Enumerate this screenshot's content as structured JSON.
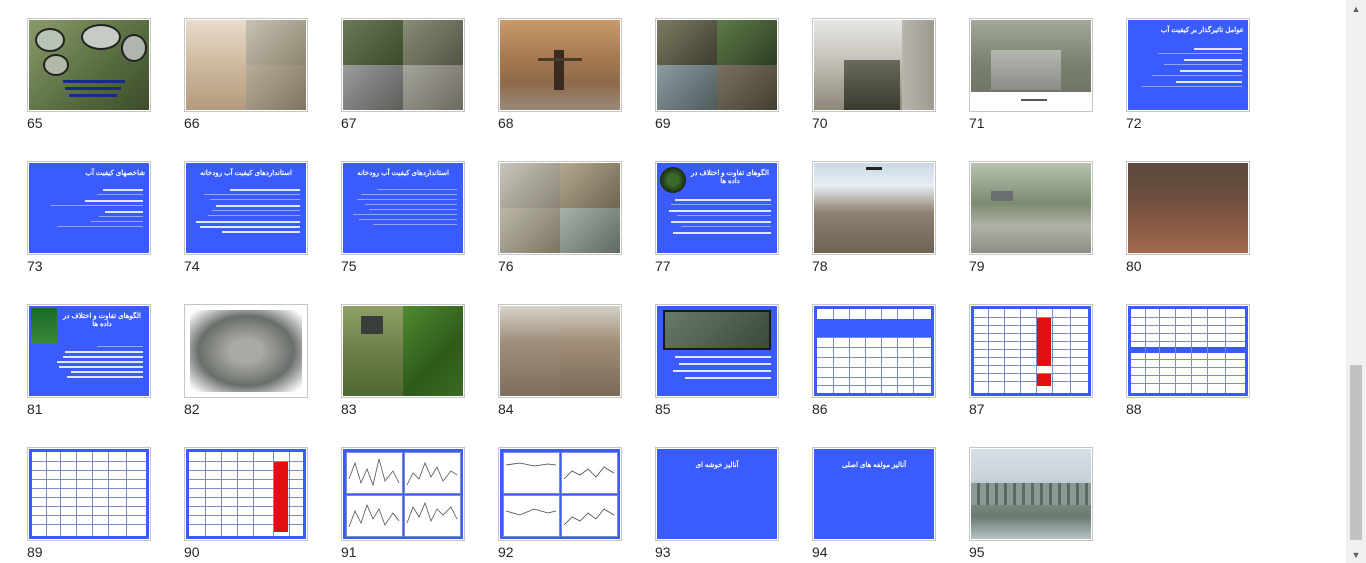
{
  "slides": [
    {
      "number": "65",
      "kind": "photo"
    },
    {
      "number": "66",
      "kind": "photo"
    },
    {
      "number": "67",
      "kind": "photo"
    },
    {
      "number": "68",
      "kind": "photo"
    },
    {
      "number": "69",
      "kind": "photo"
    },
    {
      "number": "70",
      "kind": "photo"
    },
    {
      "number": "71",
      "kind": "photo"
    },
    {
      "number": "72",
      "kind": "text",
      "title": "عوامل تاثیرگذار بر کیفیت آب"
    },
    {
      "number": "73",
      "kind": "text",
      "title": "شاخصهای کیفیت آب"
    },
    {
      "number": "74",
      "kind": "text",
      "title": "استانداردهای کیفیت آب رودخانه"
    },
    {
      "number": "75",
      "kind": "text",
      "title": "استانداردهای کیفیت آب رودخانه"
    },
    {
      "number": "76",
      "kind": "photo"
    },
    {
      "number": "77",
      "kind": "text",
      "title": "الگوهای تفاوت و اختلاف در داده ها"
    },
    {
      "number": "78",
      "kind": "photo"
    },
    {
      "number": "79",
      "kind": "photo"
    },
    {
      "number": "80",
      "kind": "photo"
    },
    {
      "number": "81",
      "kind": "text",
      "title": "الگوهای تفاوت و اختلاف در داده ها"
    },
    {
      "number": "82",
      "kind": "photo"
    },
    {
      "number": "83",
      "kind": "photo"
    },
    {
      "number": "84",
      "kind": "photo"
    },
    {
      "number": "85",
      "kind": "text",
      "title": ""
    },
    {
      "number": "86",
      "kind": "table"
    },
    {
      "number": "87",
      "kind": "table"
    },
    {
      "number": "88",
      "kind": "table"
    },
    {
      "number": "89",
      "kind": "table"
    },
    {
      "number": "90",
      "kind": "table"
    },
    {
      "number": "91",
      "kind": "chart"
    },
    {
      "number": "92",
      "kind": "chart"
    },
    {
      "number": "93",
      "kind": "text",
      "title": "آنالیز خوشه ای"
    },
    {
      "number": "94",
      "kind": "text",
      "title": "آنالیز مولفه های اصلی"
    },
    {
      "number": "95",
      "kind": "photo"
    }
  ],
  "scrollbar": {
    "up_icon": "▲",
    "down_icon": "▼"
  }
}
